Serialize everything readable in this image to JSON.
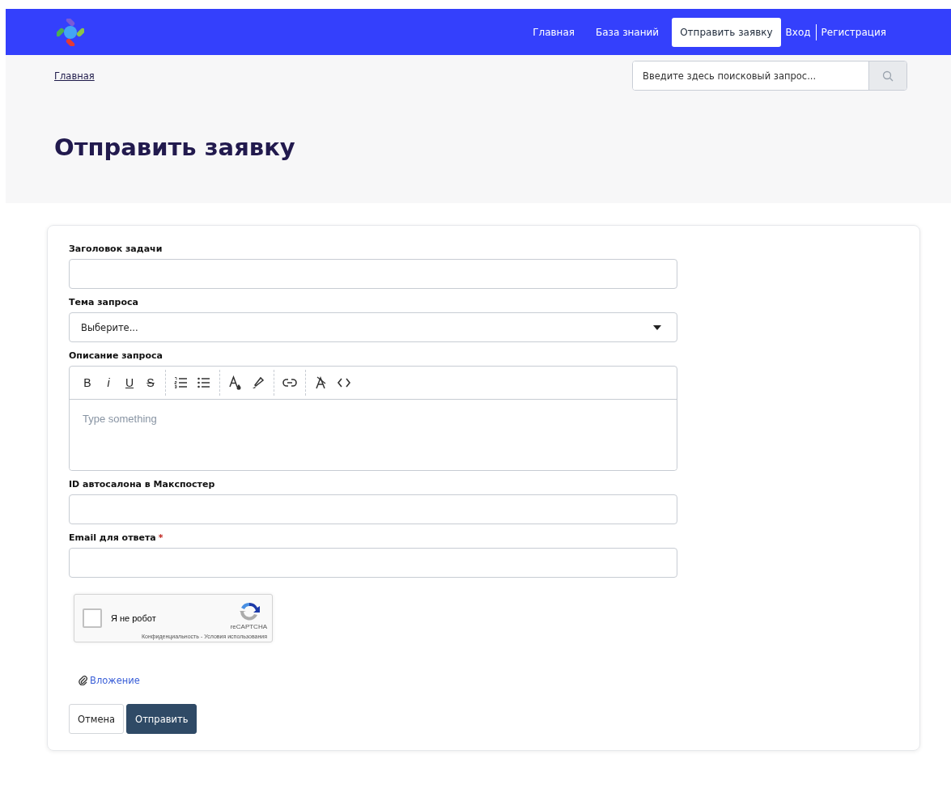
{
  "nav": {
    "links": [
      {
        "label": "Главная",
        "selected": false
      },
      {
        "label": "База знаний",
        "selected": false
      },
      {
        "label": "Отправить заявку",
        "selected": true
      }
    ],
    "login": "Вход",
    "register": "Регистрация"
  },
  "breadcrumb": "Главная",
  "search": {
    "placeholder": "Введите здесь поисковый запрос..."
  },
  "page_title": "Отправить заявку",
  "required_mark": "*",
  "fields": [
    {
      "kind": "text",
      "label": "Заголовок задачи",
      "required": false
    },
    {
      "kind": "select",
      "label": "Тема запроса",
      "required": false,
      "value": "Выберите..."
    },
    {
      "kind": "editor",
      "label": "Описание запроса",
      "required": false,
      "placeholder": "Type something",
      "toolbar": [
        [
          {
            "kind": "bold",
            "label": "B"
          },
          {
            "kind": "italic",
            "label": "i"
          },
          {
            "kind": "underline",
            "label": "U"
          },
          {
            "kind": "strike",
            "label": "S"
          }
        ],
        [
          {
            "kind": "ordered-list"
          },
          {
            "kind": "bullet-list"
          }
        ],
        [
          {
            "kind": "text-color"
          },
          {
            "kind": "highlight"
          }
        ],
        [
          {
            "kind": "link"
          }
        ],
        [
          {
            "kind": "clear-format"
          },
          {
            "kind": "code"
          }
        ]
      ]
    },
    {
      "kind": "text",
      "label": "ID автосалона в Макспостер",
      "required": false
    },
    {
      "kind": "text",
      "label": "Email для ответа",
      "required": true
    }
  ],
  "captcha": {
    "checked": false,
    "label": "Я не робот",
    "brand": "reCAPTCHA",
    "privacy": "Конфиденциальность",
    "separator": "-",
    "terms": "Условия использования"
  },
  "attachment": "Вложение",
  "buttons": [
    {
      "kind": "secondary",
      "label": "Отмена"
    },
    {
      "kind": "primary",
      "label": "Отправить"
    }
  ]
}
